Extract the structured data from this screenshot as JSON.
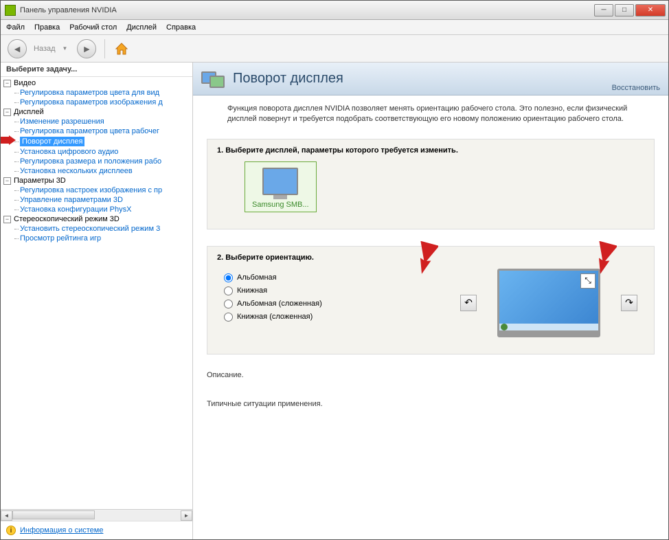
{
  "window": {
    "title": "Панель управления NVIDIA"
  },
  "menubar": {
    "file": "Файл",
    "edit": "Правка",
    "desktop": "Рабочий стол",
    "display": "Дисплей",
    "help": "Справка"
  },
  "toolbar": {
    "back_label": "Назад"
  },
  "sidebar": {
    "task_label": "Выберите задачу...",
    "groups": [
      {
        "label": "Видео",
        "items": [
          "Регулировка параметров цвета для вид",
          "Регулировка параметров изображения д"
        ]
      },
      {
        "label": "Дисплей",
        "items": [
          "Изменение разрешения",
          "Регулировка параметров цвета рабочег",
          "Поворот дисплея",
          "Установка цифрового аудио",
          "Регулировка размера и положения рабо",
          "Установка нескольких дисплеев"
        ]
      },
      {
        "label": "Параметры 3D",
        "items": [
          "Регулировка настроек изображения с пр",
          "Управление параметрами 3D",
          "Установка конфигурации PhysX"
        ]
      },
      {
        "label": "Стереоскопический режим 3D",
        "items": [
          "Установить стереоскопический режим 3",
          "Просмотр рейтинга игр"
        ]
      }
    ],
    "info_link": "Информация о системе"
  },
  "content": {
    "title": "Поворот дисплея",
    "restore": "Восстановить",
    "description": "Функция поворота дисплея NVIDIA позволяет менять ориентацию рабочего стола. Это полезно, если физический дисплей повернут и требуется подобрать соответствующую его новому положению ориентацию рабочего стола.",
    "step1_title": "1. Выберите дисплей, параметры которого требуется изменить.",
    "display_name": "Samsung SMB...",
    "step2_title": "2. Выберите ориентацию.",
    "orientations": [
      "Альбомная",
      "Книжная",
      "Альбомная (сложенная)",
      "Книжная (сложенная)"
    ],
    "selected_orientation": 0,
    "desc_label": "Описание.",
    "usage_label": "Типичные ситуации применения."
  }
}
